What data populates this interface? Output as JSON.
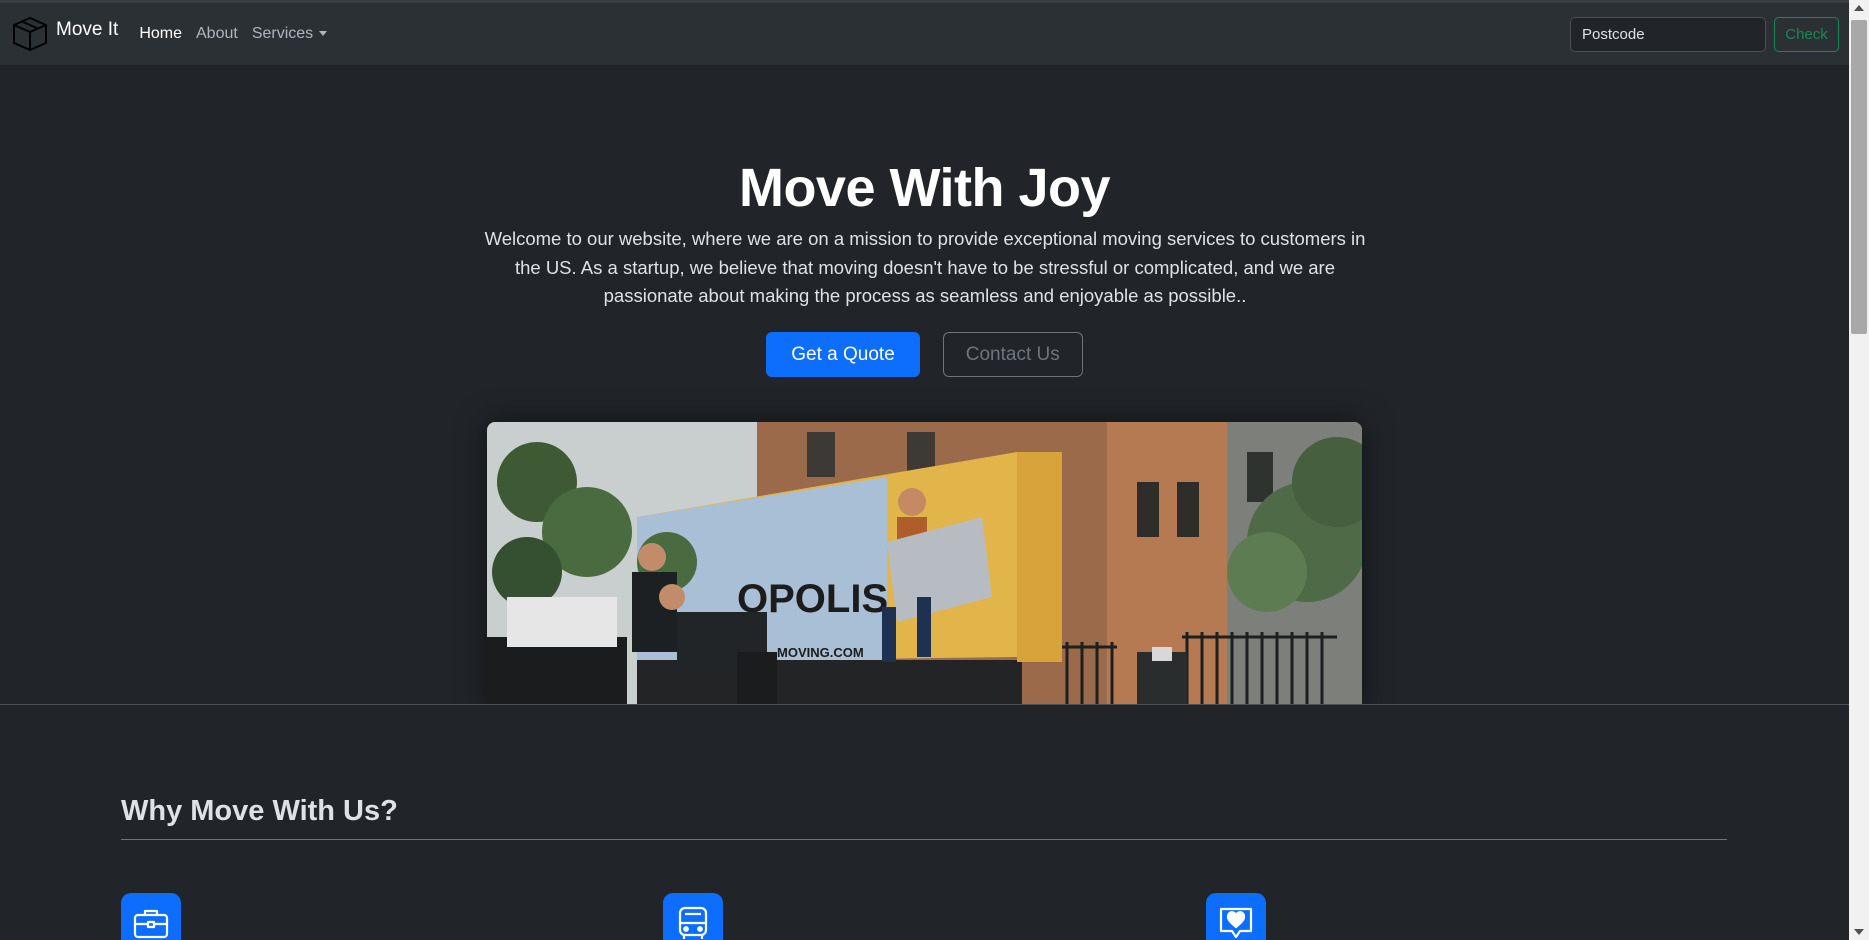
{
  "navbar": {
    "brand": "Move It",
    "brand_icon": "box-icon",
    "links": [
      {
        "label": "Home",
        "active": true
      },
      {
        "label": "About",
        "active": false
      },
      {
        "label": "Services",
        "active": false,
        "dropdown": true
      }
    ],
    "postcode_placeholder": "Postcode",
    "check_label": "Check"
  },
  "hero": {
    "title": "Move With Joy",
    "lead": "Welcome to our website, where we are on a mission to provide exceptional moving services to customers in the US. As a startup, we believe that moving doesn't have to be stressful or complicated, and we are passionate about making the process as seamless and enjoyable as possible..",
    "primary_button": "Get a Quote",
    "secondary_button": "Contact Us",
    "image_alt": "Movers unloading a moving truck in front of brownstone buildings"
  },
  "features": {
    "title": "Why Move With Us?",
    "icons": [
      "briefcase-icon",
      "bus-icon",
      "chat-heart-icon"
    ]
  },
  "colors": {
    "background": "#212529",
    "navbar": "#2b3035",
    "primary": "#0d6efd",
    "success": "#198754",
    "secondary": "#6c757d"
  }
}
